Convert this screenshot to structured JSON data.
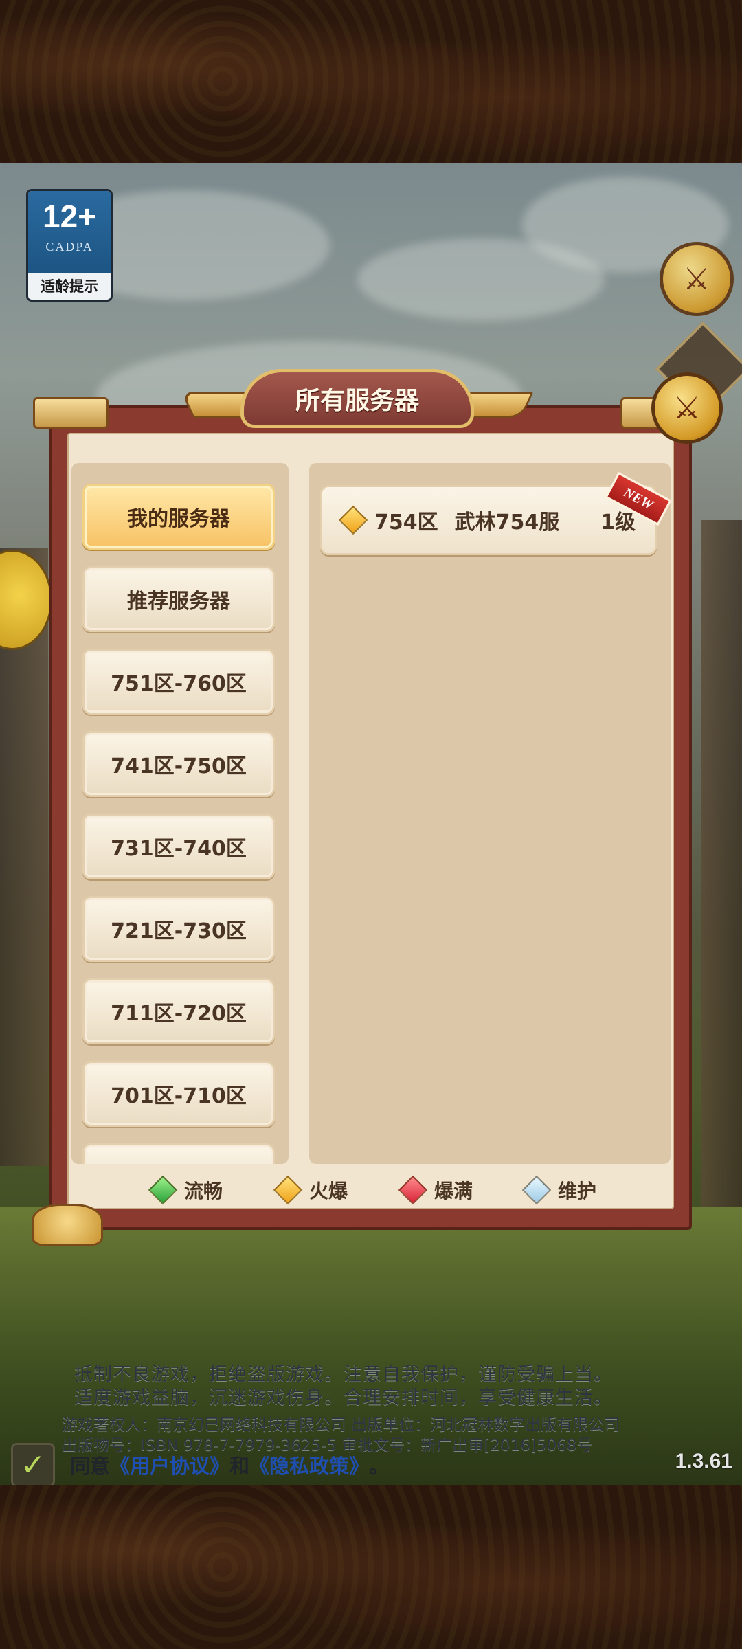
{
  "age_rating": {
    "number": "12+",
    "org": "CADPA",
    "label": "适龄提示"
  },
  "dialog": {
    "title": "所有服务器"
  },
  "server_groups": [
    {
      "label": "我的服务器",
      "selected": true
    },
    {
      "label": "推荐服务器",
      "selected": false
    },
    {
      "label": "751区-760区",
      "selected": false
    },
    {
      "label": "741区-750区",
      "selected": false
    },
    {
      "label": "731区-740区",
      "selected": false
    },
    {
      "label": "721区-730区",
      "selected": false
    },
    {
      "label": "711区-720区",
      "selected": false
    },
    {
      "label": "701区-710区",
      "selected": false
    }
  ],
  "servers": [
    {
      "zone": "754区",
      "name": "武林754服",
      "level": "1级",
      "status": "hot",
      "tag": "NEW"
    }
  ],
  "legend": [
    {
      "label": "流畅",
      "status": "smooth",
      "color": "#2aa33a"
    },
    {
      "label": "火爆",
      "status": "hot",
      "color": "#f0a21a"
    },
    {
      "label": "爆满",
      "status": "full",
      "color": "#d8253a"
    },
    {
      "label": "维护",
      "status": "maint",
      "color": "#9fcbe6"
    }
  ],
  "notice": {
    "line1": "抵制不良游戏，拒绝盗版游戏。注意自我保护，谨防受骗上当。",
    "line2": "适度游戏益脑，沉迷游戏伤身。合理安排时间，享受健康生活。",
    "line3": "游戏著权人：南京幻巳网络科技有限公司  出版单位：河北冠林数字出版有限公司",
    "line4": "出版物号：ISBN 978-7-7979-3625-5  审批文号：新广出审[2016]5068号"
  },
  "agreement": {
    "prefix": "同意",
    "user_agreement": "《用户协议》",
    "conjunction": "和",
    "privacy_policy": "《隐私政策》",
    "suffix": "。"
  },
  "version": "1.3.61"
}
